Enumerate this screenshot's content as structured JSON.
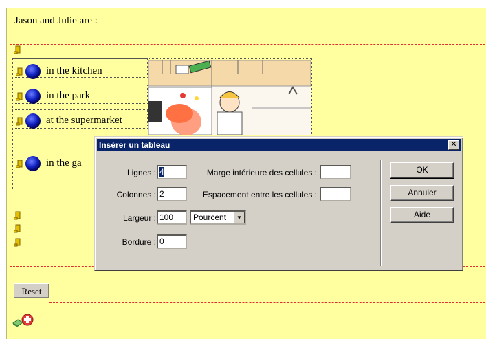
{
  "question": "Jason and Julie are :",
  "answers": [
    {
      "label": "in the kitchen"
    },
    {
      "label": "in the park"
    },
    {
      "label": "at the supermarket"
    },
    {
      "label": "in the ga"
    }
  ],
  "reset_label": "Reset",
  "dialog": {
    "title": "Insérer un tableau",
    "close_glyph": "✕",
    "rows_label": "Lignes :",
    "rows_value": "4",
    "cols_label": "Colonnes :",
    "cols_value": "2",
    "width_label": "Largeur :",
    "width_value": "100",
    "width_unit": "Pourcent",
    "border_label": "Bordure :",
    "border_value": "0",
    "padding_label": "Marge intérieure des cellules :",
    "padding_value": "",
    "spacing_label": "Espacement entre les cellules :",
    "spacing_value": "",
    "ok_label": "OK",
    "cancel_label": "Annuler",
    "help_label": "Aide"
  },
  "colors": {
    "page_background": "#ffffa0",
    "dashed_border": "#e03030",
    "titlebar": "#0a246a",
    "dialog_face": "#d4d0c8"
  },
  "icons": [
    "anchor-icon",
    "radio-button-icon",
    "plus-icon",
    "eraser-icon"
  ]
}
